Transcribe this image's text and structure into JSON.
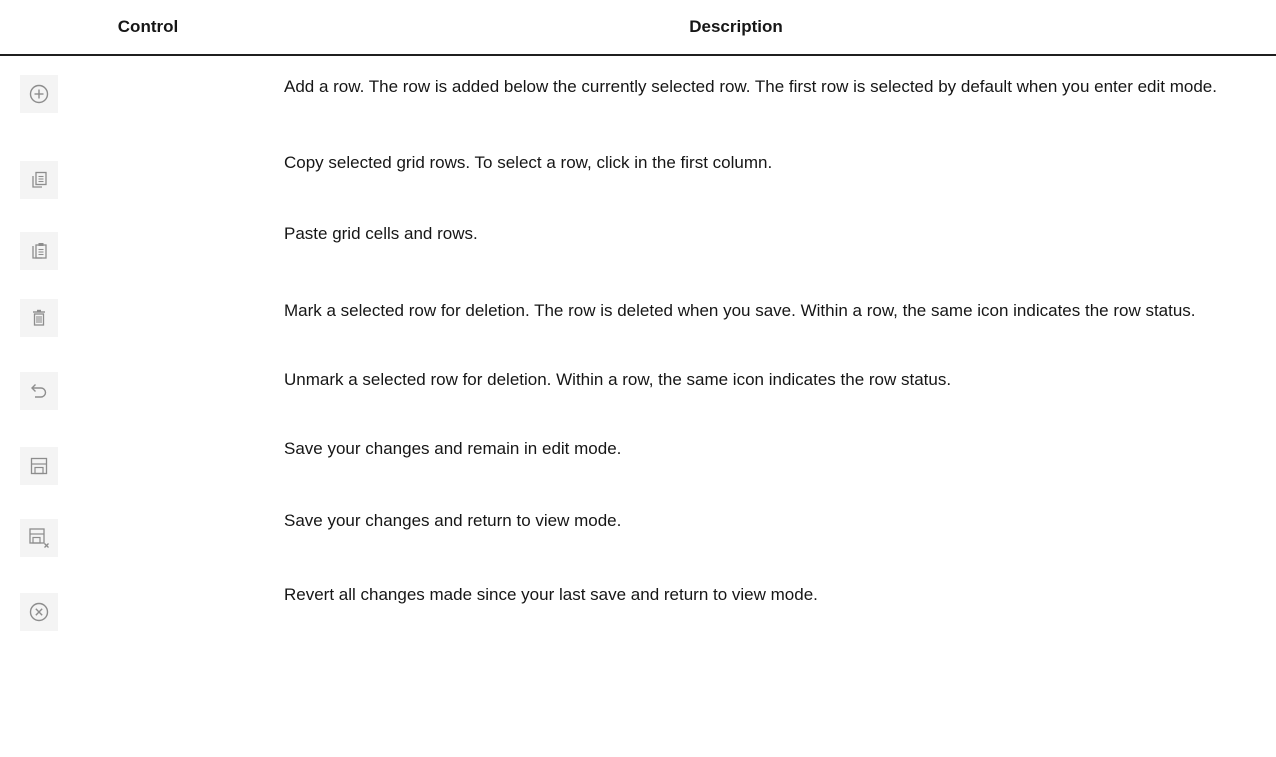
{
  "table": {
    "headers": {
      "control": "Control",
      "description": "Description"
    },
    "rows": [
      {
        "icon": "add-circle-icon",
        "description": "Add a row. The row is added below the currently selected row. The first row is selected by default when you enter edit mode."
      },
      {
        "icon": "copy-icon",
        "description": "Copy selected grid rows. To select a row, click in the first column."
      },
      {
        "icon": "paste-icon",
        "description": "Paste grid cells and rows."
      },
      {
        "icon": "trash-icon",
        "description": "Mark a selected row for deletion. The row is deleted when you save. Within a row, the same icon indicates the row status."
      },
      {
        "icon": "undo-icon",
        "description": "Unmark a selected row for deletion. Within a row, the same icon indicates the row status."
      },
      {
        "icon": "save-icon",
        "description": "Save your changes and remain in edit mode."
      },
      {
        "icon": "save-close-icon",
        "description": "Save your changes and return to view mode."
      },
      {
        "icon": "cancel-circle-icon",
        "description": "Revert all changes made since your last save and return to view mode."
      }
    ]
  },
  "colors": {
    "text": "#161616",
    "icon": "#8d8d8d",
    "icon_background": "#f4f4f4",
    "header_rule": "#1f1f1f"
  }
}
